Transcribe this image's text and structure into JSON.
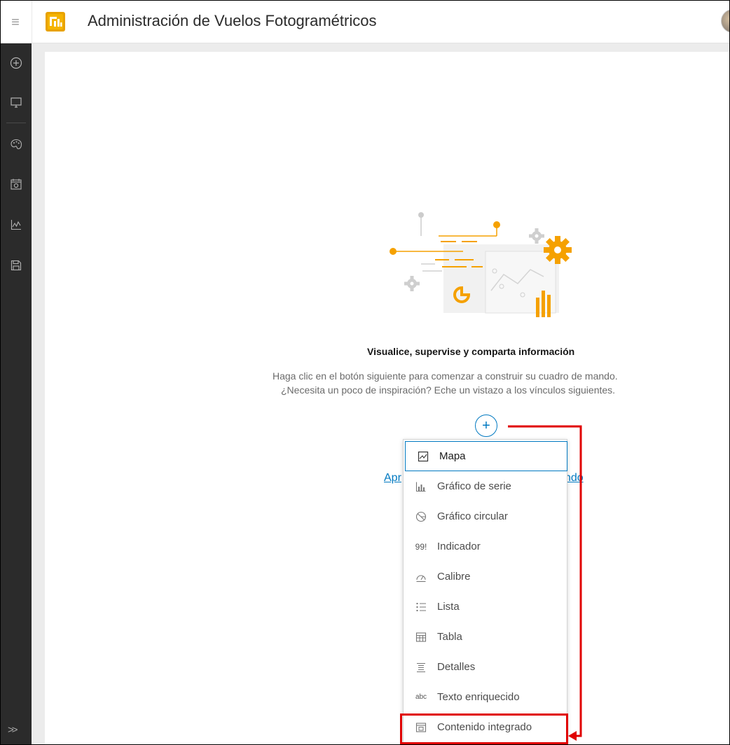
{
  "header": {
    "menu_icon": "hamburger-icon",
    "logo_icon": "dashboards-logo-icon",
    "title": "Administración de Vuelos Fotogramétricos",
    "avatar_icon": "user-avatar"
  },
  "toolbar": {
    "items": [
      {
        "icon": "add-circle-icon"
      },
      {
        "icon": "desktop-icon"
      },
      {
        "icon": "palette-icon"
      },
      {
        "icon": "dashboard-settings-icon"
      },
      {
        "icon": "chart-line-icon"
      },
      {
        "icon": "save-icon"
      }
    ],
    "expand_label": ">>"
  },
  "canvas": {
    "headline": "Visualice, supervise y comparta información",
    "line1": "Haga clic en el botón siguiente para comenzar a construir su cuadro de mando.",
    "line2": "¿Necesita un poco de inspiración? Eche un vistazo a los vínculos siguientes.",
    "add_button": "+",
    "link_left_partial": "Apr",
    "link_right_partial": "ndo"
  },
  "menu": {
    "items": [
      {
        "label": "Mapa",
        "icon": "map-icon",
        "selected": true
      },
      {
        "label": "Gráfico de serie",
        "icon": "serial-chart-icon"
      },
      {
        "label": "Gráfico circular",
        "icon": "pie-chart-icon"
      },
      {
        "label": "Indicador",
        "icon": "indicator-icon",
        "glyph": "99!"
      },
      {
        "label": "Calibre",
        "icon": "gauge-icon"
      },
      {
        "label": "Lista",
        "icon": "list-icon"
      },
      {
        "label": "Tabla",
        "icon": "table-icon"
      },
      {
        "label": "Detalles",
        "icon": "details-icon"
      },
      {
        "label": "Texto enriquecido",
        "icon": "rich-text-icon",
        "glyph": "abc"
      },
      {
        "label": "Contenido integrado",
        "icon": "embedded-content-icon",
        "highlighted": true
      }
    ]
  },
  "colors": {
    "accent": "#0079c1",
    "illustration": "#f5a100",
    "annotation": "#e00000",
    "toolbar_bg": "#2b2b2b"
  }
}
